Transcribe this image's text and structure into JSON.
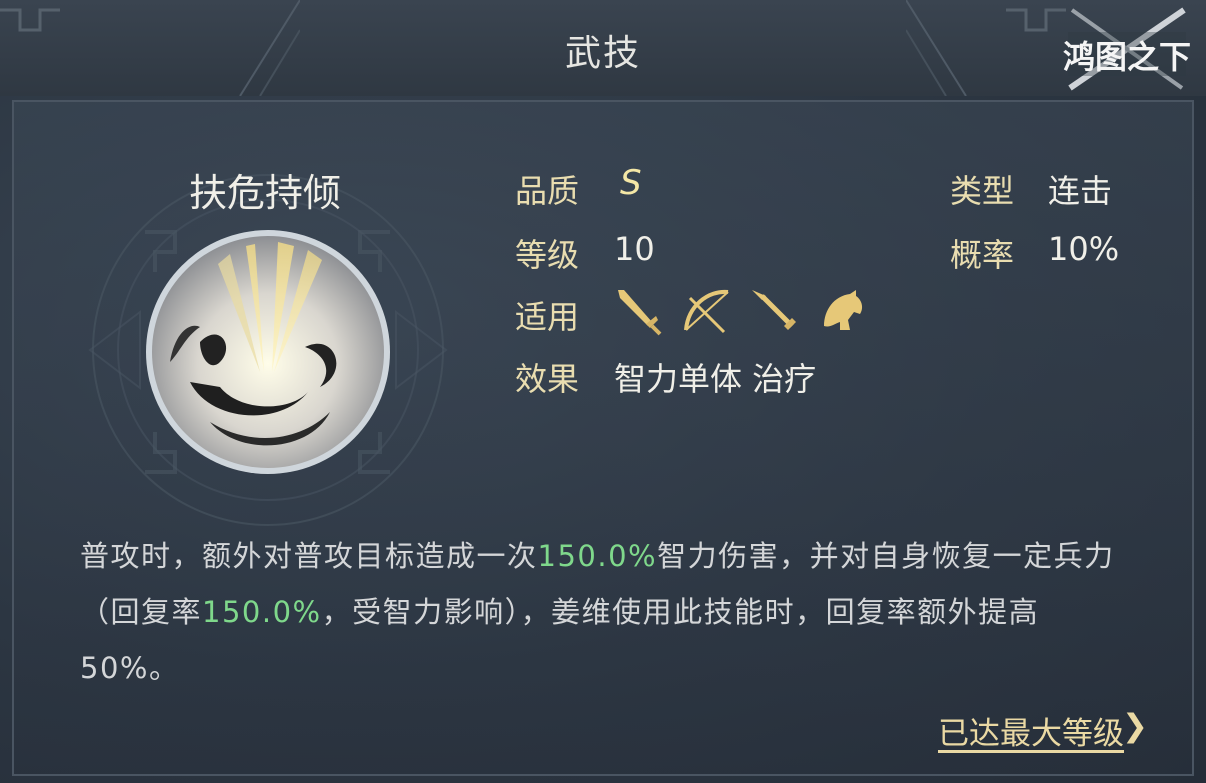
{
  "header": {
    "title": "武技"
  },
  "logo": {
    "text": "鸿图之下"
  },
  "skill": {
    "name": "扶危持倾",
    "quality_label": "品质",
    "quality_value": "S",
    "type_label": "类型",
    "type_value": "连击",
    "level_label": "等级",
    "level_value": "10",
    "rate_label": "概率",
    "rate_value": "10%",
    "applicable_label": "适用",
    "applicable_icons": [
      "sword-icon",
      "bow-icon",
      "spear-icon",
      "horse-icon"
    ],
    "effect_label": "效果",
    "effect_value": "智力单体 治疗"
  },
  "description": {
    "p1": "普攻时，额外对普攻目标造成一次",
    "v1": "150.0%",
    "p2": "智力伤害，并对自身恢复一定兵力（回复率",
    "v2": "150.0%",
    "p3": "，受智力影响），姜维使用此技能时，回复率额外提高50%。"
  },
  "footer": {
    "max_level_link": "已达最大等级",
    "chevron": "❯"
  },
  "colors": {
    "accent_gold": "#e9ddb0",
    "highlight_green": "#7fd88b",
    "background": "#2c3642"
  }
}
